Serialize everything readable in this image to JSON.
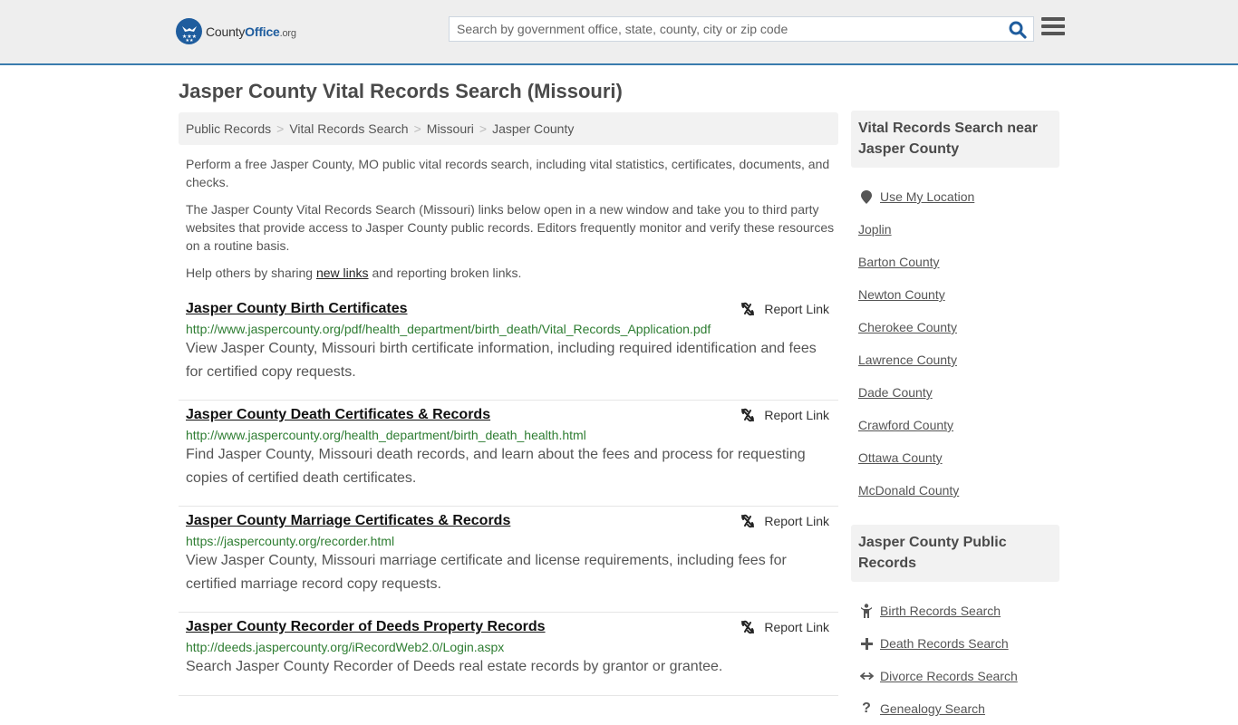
{
  "header": {
    "logo": {
      "county": "County",
      "office": "Office",
      "org": ".org"
    },
    "search_placeholder": "Search by government office, state, county, city or zip code",
    "search_icon": "search-icon",
    "menu_icon": "hamburger-menu-icon"
  },
  "page": {
    "title": "Jasper County Vital Records Search (Missouri)"
  },
  "breadcrumb": [
    {
      "label": "Public Records"
    },
    {
      "label": "Vital Records Search"
    },
    {
      "label": "Missouri"
    },
    {
      "label": "Jasper County"
    }
  ],
  "breadcrumb_separator": ">",
  "intro": {
    "p1": "Perform a free Jasper County, MO public vital records search, including vital statistics, certificates, documents, and checks.",
    "p2": "The Jasper County Vital Records Search (Missouri) links below open in a new window and take you to third party websites that provide access to Jasper County public records. Editors frequently monitor and verify these resources on a routine basis.",
    "p3_before": "Help others by sharing ",
    "p3_link": "new links",
    "p3_after": " and reporting broken links."
  },
  "results": [
    {
      "title": "Jasper County Birth Certificates",
      "url": "http://www.jaspercounty.org/pdf/health_department/birth_death/Vital_Records_Application.pdf",
      "description": "View Jasper County, Missouri birth certificate information, including required identification and fees for certified copy requests.",
      "report_label": "Report Link"
    },
    {
      "title": "Jasper County Death Certificates & Records",
      "url": "http://www.jaspercounty.org/health_department/birth_death_health.html",
      "description": "Find Jasper County, Missouri death records, and learn about the fees and process for requesting copies of certified death certificates.",
      "report_label": "Report Link"
    },
    {
      "title": "Jasper County Marriage Certificates & Records",
      "url": "https://jaspercounty.org/recorder.html",
      "description": "View Jasper County, Missouri marriage certificate and license requirements, including fees for certified marriage record copy requests.",
      "report_label": "Report Link"
    },
    {
      "title": "Jasper County Recorder of Deeds Property Records",
      "url": "http://deeds.jaspercounty.org/iRecordWeb2.0/Login.aspx",
      "description": "Search Jasper County Recorder of Deeds real estate records by grantor or grantee.",
      "report_label": "Report Link"
    }
  ],
  "sidebar": {
    "nearby_heading": "Vital Records Search near Jasper County",
    "use_location": "Use My Location",
    "nearby": [
      "Joplin",
      "Barton County",
      "Newton County",
      "Cherokee County",
      "Lawrence County",
      "Dade County",
      "Crawford County",
      "Ottawa County",
      "McDonald County"
    ],
    "public_records_heading": "Jasper County Public Records",
    "public_records": [
      {
        "label": "Birth Records Search",
        "icon": "child-icon"
      },
      {
        "label": "Death Records Search",
        "icon": "plus-icon"
      },
      {
        "label": "Divorce Records Search",
        "icon": "arrows-horizontal-icon"
      },
      {
        "label": "Genealogy Search",
        "icon": "question-icon"
      }
    ]
  },
  "colors": {
    "brand_blue": "#1f5d9e",
    "header_border": "#3a7cad",
    "url_green": "#2e7d32"
  }
}
